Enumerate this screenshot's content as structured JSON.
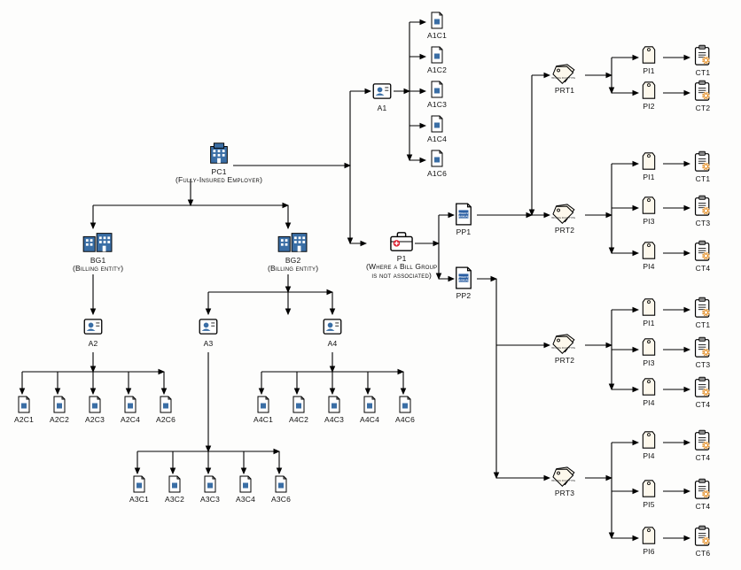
{
  "nodes": {
    "pc1": {
      "label": "PC1\n(Fully-Insured Employer)"
    },
    "bg1": {
      "label": "BG1\n(Billing entity)"
    },
    "bg2": {
      "label": "BG2\n(Billing entity)"
    },
    "a1": {
      "label": "A1"
    },
    "a2": {
      "label": "A2"
    },
    "a3": {
      "label": "A3"
    },
    "a4": {
      "label": "A4"
    },
    "p1": {
      "label": "P1\n(Where a Bill Group\nis not associated)"
    },
    "pp1": {
      "label": "PP1"
    },
    "pp2": {
      "label": "PP2"
    },
    "prt1": {
      "label": "PRT1"
    },
    "prt2a": {
      "label": "PRT2"
    },
    "prt2b": {
      "label": "PRT2"
    },
    "prt3": {
      "label": "PRT3"
    },
    "a1c1": {
      "label": "A1C1"
    },
    "a1c2": {
      "label": "A1C2"
    },
    "a1c3": {
      "label": "A1C3"
    },
    "a1c4": {
      "label": "A1C4"
    },
    "a1c6": {
      "label": "A1C6"
    },
    "a2c1": {
      "label": "A2C1"
    },
    "a2c2": {
      "label": "A2C2"
    },
    "a2c3": {
      "label": "A2C3"
    },
    "a2c4": {
      "label": "A2C4"
    },
    "a2c6": {
      "label": "A2C6"
    },
    "a3c1": {
      "label": "A3C1"
    },
    "a3c2": {
      "label": "A3C2"
    },
    "a3c3": {
      "label": "A3C3"
    },
    "a3c4": {
      "label": "A3C4"
    },
    "a3c6": {
      "label": "A3C6"
    },
    "a4c1": {
      "label": "A4C1"
    },
    "a4c2": {
      "label": "A4C2"
    },
    "a4c3": {
      "label": "A4C3"
    },
    "a4c4": {
      "label": "A4C4"
    },
    "a4c6": {
      "label": "A4C6"
    },
    "pi1a": {
      "label": "PI1"
    },
    "pi2": {
      "label": "PI2"
    },
    "pi1b": {
      "label": "PI1"
    },
    "pi3a": {
      "label": "PI3"
    },
    "pi4a": {
      "label": "PI4"
    },
    "pi1c": {
      "label": "PI1"
    },
    "pi3b": {
      "label": "PI3"
    },
    "pi4b": {
      "label": "PI4"
    },
    "pi4c": {
      "label": "PI4"
    },
    "pi5": {
      "label": "PI5"
    },
    "pi6": {
      "label": "PI6"
    },
    "ct1a": {
      "label": "CT1"
    },
    "ct2": {
      "label": "CT2"
    },
    "ct1b": {
      "label": "CT1"
    },
    "ct3a": {
      "label": "CT3"
    },
    "ct4a": {
      "label": "CT4"
    },
    "ct1c": {
      "label": "CT1"
    },
    "ct3b": {
      "label": "CT3"
    },
    "ct4b": {
      "label": "CT4"
    },
    "ct4c": {
      "label": "CT4"
    },
    "ct4d": {
      "label": "CT4"
    },
    "ct6": {
      "label": "CT6"
    }
  }
}
